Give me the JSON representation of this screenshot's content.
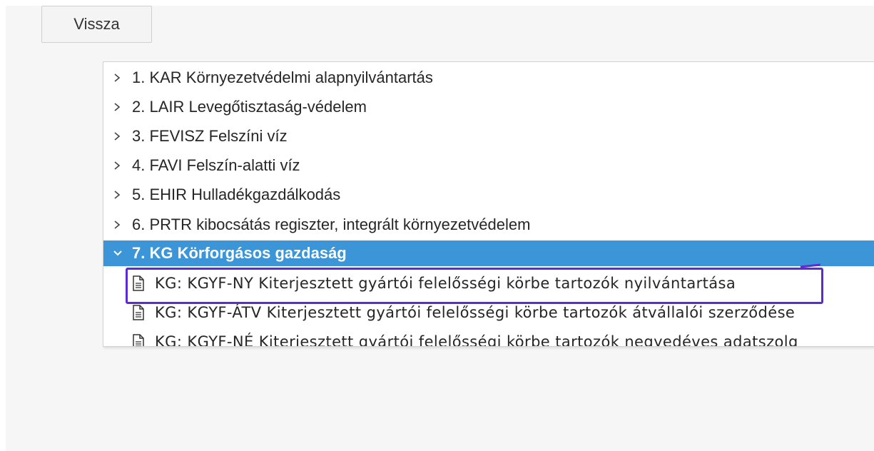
{
  "toolbar": {
    "back_label": "Vissza"
  },
  "tree": {
    "items": [
      {
        "label": "1. KAR Környezetvédelmi alapnyilvántartás",
        "expanded": false
      },
      {
        "label": "2. LAIR Levegőtisztaság-védelem",
        "expanded": false
      },
      {
        "label": "3. FEVISZ Felszíni víz",
        "expanded": false
      },
      {
        "label": "4. FAVI Felszín-alatti víz",
        "expanded": false
      },
      {
        "label": "5. EHIR Hulladékgazdálkodás",
        "expanded": false
      },
      {
        "label": "6. PRTR kibocsátás regiszter, integrált környezetvédelem",
        "expanded": false
      },
      {
        "label": "7. KG Körforgásos gazdaság",
        "expanded": true,
        "selected": true,
        "children": [
          {
            "label": "KG: KGYF-NY Kiterjesztett gyártói felelősségi körbe tartozók nyilvántartása",
            "icon": "document-icon"
          },
          {
            "label": "KG: KGYF-ÁTV Kiterjesztett gyártói felelősségi körbe tartozók átvállalói szerződése",
            "icon": "document-icon"
          },
          {
            "label": "KG: KGYF-NÉ Kiterjesztett gyártói felelősségi körbe tartozók negyedéves adatszolg",
            "icon": "document-icon"
          }
        ]
      }
    ]
  },
  "colors": {
    "selected_bg": "#3b95d6",
    "annotation": "#5b2ccf",
    "text": "#262626"
  }
}
